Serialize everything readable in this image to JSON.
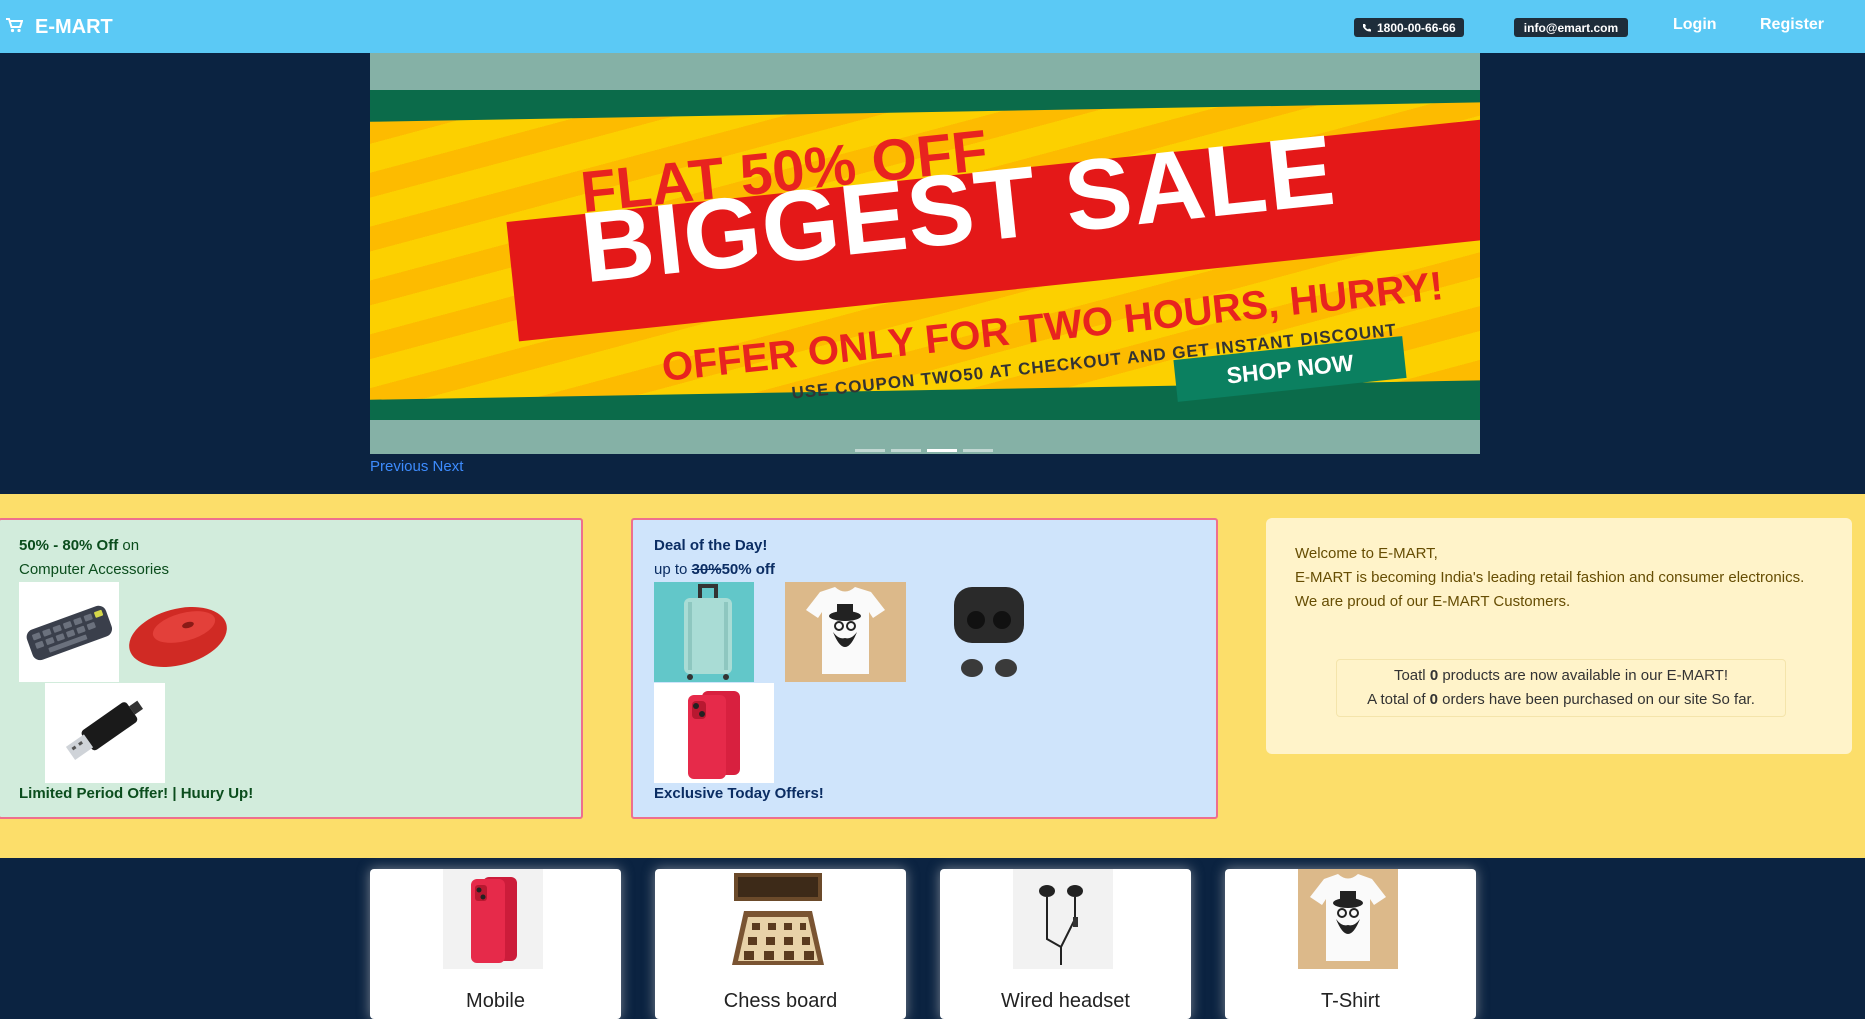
{
  "header": {
    "brand": "E-MART",
    "phone": "1800-00-66-66",
    "email": "info@emart.com",
    "login": "Login",
    "register": "Register"
  },
  "carousel": {
    "slide": {
      "line1": "FLAT 50% OFF",
      "line2": "BIGGEST SALE",
      "line3": "OFFER ONLY FOR TWO HOURS, HURRY!",
      "line4": "USE COUPON TWO50 AT CHECKOUT AND GET INSTANT DISCOUNT",
      "cta": "SHOP NOW"
    },
    "indicator_count": 4,
    "active_indicator": 3,
    "previous": "Previous",
    "next": "Next"
  },
  "offer_cards": {
    "accessories": {
      "highlight": "50% - 80% Off",
      "on": "on",
      "category": "Computer Accessories",
      "footer": "Limited Period Offer! | Huury Up!",
      "images": [
        "keyboard",
        "mouse",
        "usb-drive"
      ]
    },
    "deal": {
      "title": "Deal of the Day!",
      "up_to": "up to",
      "strike": "30%",
      "discount": "50% off",
      "footer": "Exclusive Today Offers!",
      "images": [
        "suitcase",
        "tshirt",
        "earbuds",
        "phone"
      ]
    },
    "welcome": {
      "line1": "Welcome to E-MART,",
      "line2": "E-MART is becoming India's leading retail fashion and consumer electronics.",
      "line3": "We are proud of our E-MART Customers.",
      "stat1_pre": "Toatl",
      "stat1_num": "0",
      "stat1_post": "products are now available in our E-MART!",
      "stat2_pre": "A total of",
      "stat2_num": "0",
      "stat2_post": "orders have been purchased on our site So far."
    }
  },
  "products": [
    {
      "name": "Mobile"
    },
    {
      "name": "Chess board"
    },
    {
      "name": "Wired headset"
    },
    {
      "name": "T-Shirt"
    }
  ],
  "colors": {
    "topbar": "#5bc9f5",
    "page_bg": "#0b2341",
    "offers_bg": "#fcde6a",
    "card_border": "#ee6f8d"
  }
}
